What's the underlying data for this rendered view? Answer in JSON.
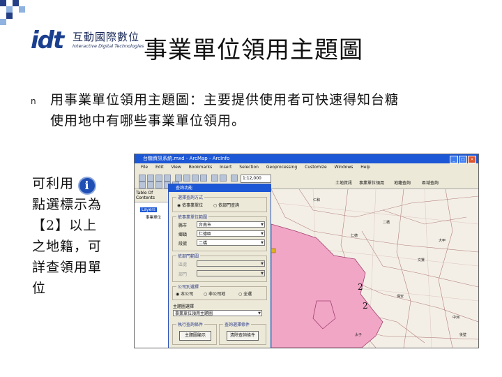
{
  "decor": {
    "squares": [
      "#243f85",
      "#8fb2e0",
      "#243f85",
      "#8fb2e0",
      "#243f85",
      "#8fb2e0"
    ]
  },
  "logo": {
    "mark": "idt",
    "cn": "互動國際數位",
    "en": "Interactive Digital Technologies"
  },
  "slide": {
    "title": "事業單位領用主題圖",
    "bullet_glyph": "n",
    "body_lines": [
      "用事業單位領用主題圖：主要提供使用者可快速得知台糖",
      "使用地中有哪些事業單位領用。"
    ],
    "side_note_lines": [
      "可利用",
      "點選標示為",
      "【2】以上",
      "之地籍，可",
      "詳查領用單",
      "位"
    ],
    "info_icon_glyph": "i"
  },
  "app": {
    "window_title": "台糖資訊系統.mxd - ArcMap - ArcInfo",
    "window_buttons": [
      "_",
      "□",
      "×"
    ],
    "menu": [
      "File",
      "Edit",
      "View",
      "Bookmarks",
      "Insert",
      "Selection",
      "Geoprocessing",
      "Customize",
      "Windows",
      "Help"
    ],
    "scale": "1:12,000",
    "toolbar_buttons": [
      "土地資訊",
      "事業單位領用",
      "地籍查詢",
      "區域查詢"
    ],
    "toc_title": "Table Of Contents",
    "toc_layers": "Layers",
    "toc_layer2": "事業單位"
  },
  "dialog": {
    "title": "查詢功能",
    "group1": "選擇查詢方式",
    "radio_a": "依事業單位",
    "radio_b": "依部門查詢",
    "group2": "依事業單位範圍",
    "f1_label": "縣市",
    "f1_value": "台南市",
    "f2_label": "鄉鎮",
    "f2_value": "仁德區",
    "f3_label": "段號",
    "f3_value": "二橋",
    "group3": "依部門範圍",
    "f4_label": "區處",
    "f5_label": "部門",
    "group4": "公司別選擇",
    "r1": "本公司",
    "r2": "非公司地",
    "r3": "全選",
    "theme_label": "主題圖選擇",
    "theme_value": "事業單位領用主題圖",
    "group5a": "執行查詢條件",
    "group5b": "查詢選擇條件",
    "btn1": "主題圖顯示",
    "btn2": "清除查詢條件"
  },
  "map": {
    "labels": [
      "2",
      "2"
    ],
    "place_labels": [
      "仁德",
      "二橋",
      "文賢",
      "保安",
      "大甲",
      "仁和",
      "中洲",
      "太子",
      "後壁"
    ]
  }
}
